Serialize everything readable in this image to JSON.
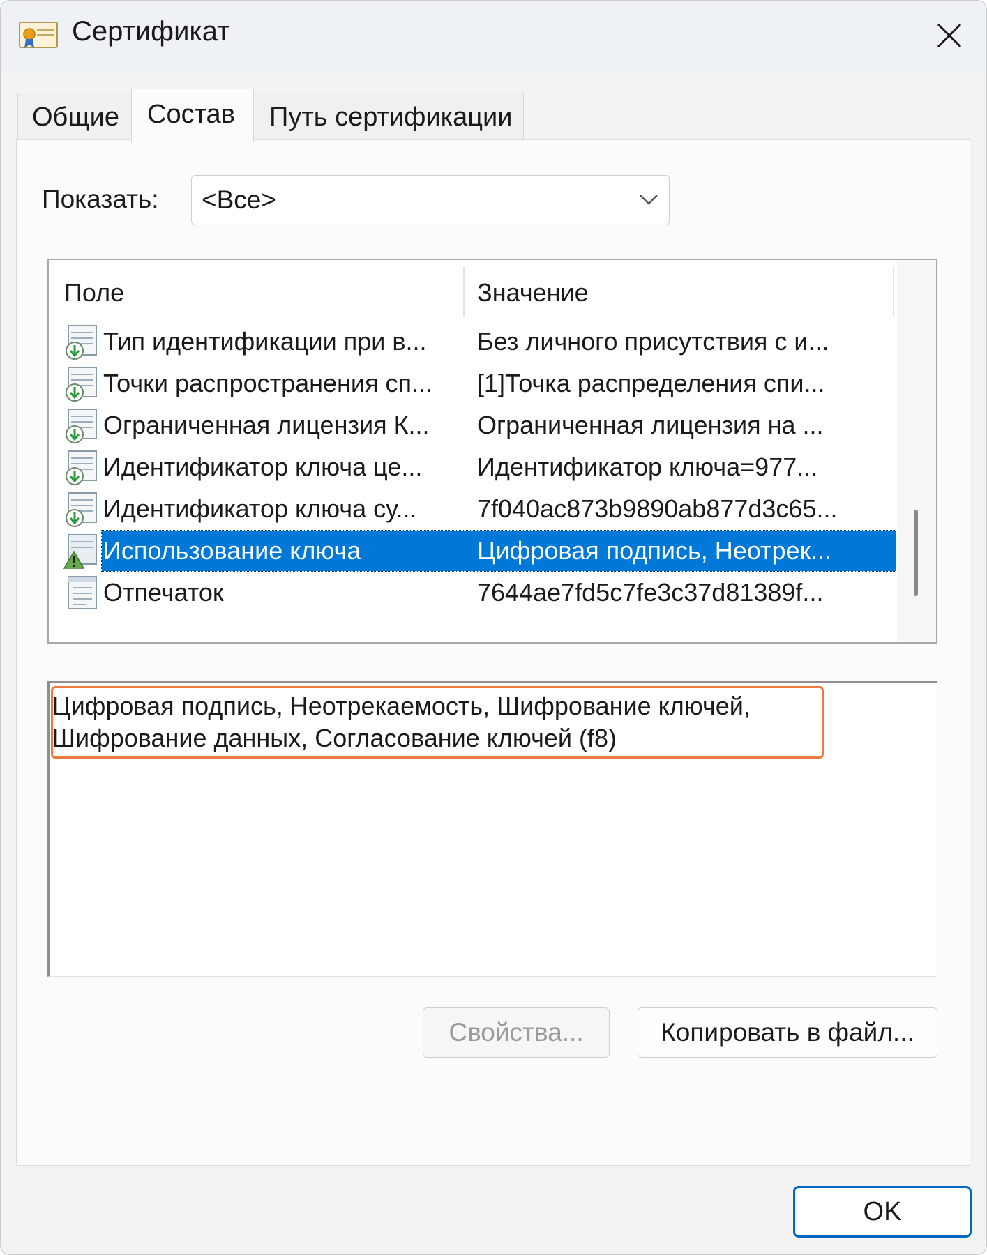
{
  "window": {
    "title": "Сертификат",
    "icon": "certificate-icon",
    "close_icon": "close-icon"
  },
  "tabs": [
    {
      "label": "Общие",
      "selected": false
    },
    {
      "label": "Состав",
      "selected": true
    },
    {
      "label": "Путь сертификации",
      "selected": false
    }
  ],
  "show": {
    "label": "Показать:",
    "value": "<Все>"
  },
  "list": {
    "headers": {
      "field": "Поле",
      "value": "Значение"
    },
    "rows": [
      {
        "field": "Тип идентификации при в...",
        "value": "Без личного присутствия с и...",
        "icon": "certificate-extension-icon",
        "selected": false
      },
      {
        "field": "Точки распространения сп...",
        "value": "[1]Точка распределения спи...",
        "icon": "certificate-extension-icon",
        "selected": false
      },
      {
        "field": "Ограниченная лицензия К...",
        "value": "Ограниченная лицензия на ...",
        "icon": "certificate-extension-icon",
        "selected": false
      },
      {
        "field": "Идентификатор ключа це...",
        "value": "Идентификатор ключа=977...",
        "icon": "certificate-extension-icon",
        "selected": false
      },
      {
        "field": "Идентификатор ключа су...",
        "value": "7f040ac873b9890ab877d3c65...",
        "icon": "certificate-extension-icon",
        "selected": false
      },
      {
        "field": "Использование ключа",
        "value": "Цифровая подпись, Неотрек...",
        "icon": "critical-extension-warning-icon",
        "selected": true
      },
      {
        "field": "Отпечаток",
        "value": "7644ae7fd5c7fe3c37d81389f...",
        "icon": "certificate-property-icon",
        "selected": false
      }
    ]
  },
  "detail": {
    "line1": "Цифровая подпись, Неотрекаемость, Шифрование ключей,",
    "line2": "Шифрование данных, Согласование ключей (f8)"
  },
  "buttons": {
    "properties": "Свойства...",
    "copy_to_file": "Копировать в файл...",
    "ok": "OK"
  },
  "colors": {
    "selection": "#0078d7",
    "highlight_frame": "#ec7a3d",
    "ok_border": "#0067c0"
  }
}
